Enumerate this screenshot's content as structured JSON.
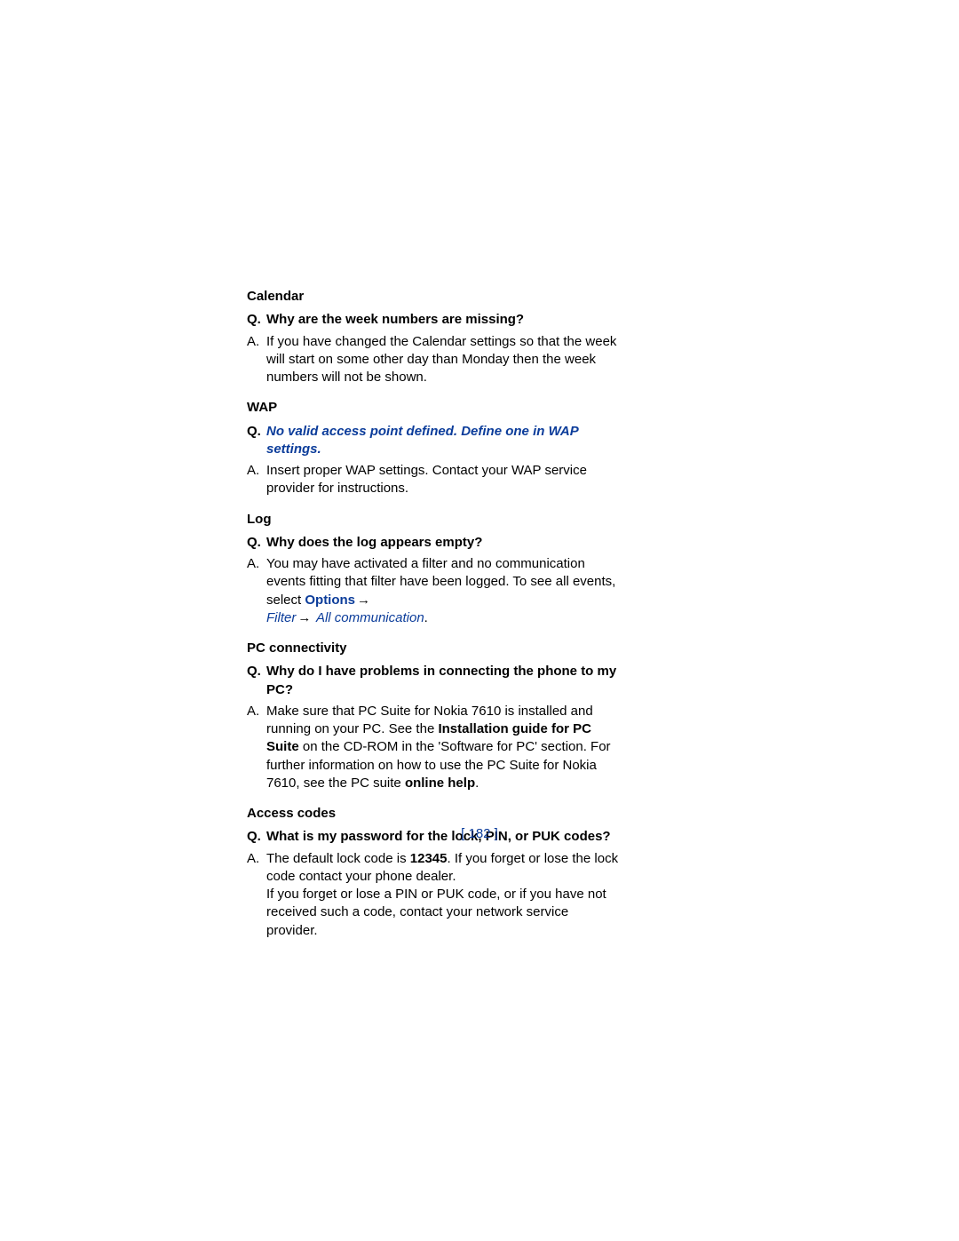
{
  "sections": {
    "calendar": {
      "heading": "Calendar",
      "q_label": "Q.",
      "q_text": "Why are the week numbers are missing?",
      "a_label": "A.",
      "a_text": "If you have changed the Calendar settings so that the week will start on some other day than Monday then the week numbers will not be shown."
    },
    "wap": {
      "heading": "WAP",
      "q_label": "Q.",
      "q_text": "No valid access point defined. Define one in WAP settings.",
      "a_label": "A.",
      "a_text": "Insert proper WAP settings. Contact your WAP service provider for instructions."
    },
    "log": {
      "heading": "Log",
      "q_label": "Q.",
      "q_text": "Why does the log appears empty?",
      "a_label": "A.",
      "a_pre": "You may have activated a filter and no communication events fitting that filter have been logged. To see all events, select ",
      "options_label": "Options",
      "arrow1": "→",
      "filter_label": "Filter",
      "arrow2": "→",
      "allcomm_label": " All communication",
      "a_post": "."
    },
    "pc": {
      "heading": "PC connectivity",
      "q_label": "Q.",
      "q_text": "Why do I have problems in connecting the phone to my PC?",
      "a_label": "A.",
      "a_part1": "Make sure that PC Suite for Nokia 7610 is installed and running on your PC. See the ",
      "install_guide": "Installation guide for PC Suite",
      "a_part2": " on the CD-ROM in the 'Software for PC' section. For further information on how to use the PC Suite for Nokia 7610, see the PC suite ",
      "online_help": "online help",
      "a_part3": "."
    },
    "access": {
      "heading": "Access codes",
      "q_label": "Q.",
      "q_text": "What is my password for the lock, PIN, or PUK codes?",
      "a_label": "A.",
      "a_part1": "The default lock code is ",
      "code": "12345",
      "a_part2": ". If you forget or lose the lock code contact your phone dealer.",
      "a_part3": "If you forget or lose a PIN or PUK code, or if you have not received such a code, contact your network service provider."
    }
  },
  "page_number": "[ 182 ]"
}
